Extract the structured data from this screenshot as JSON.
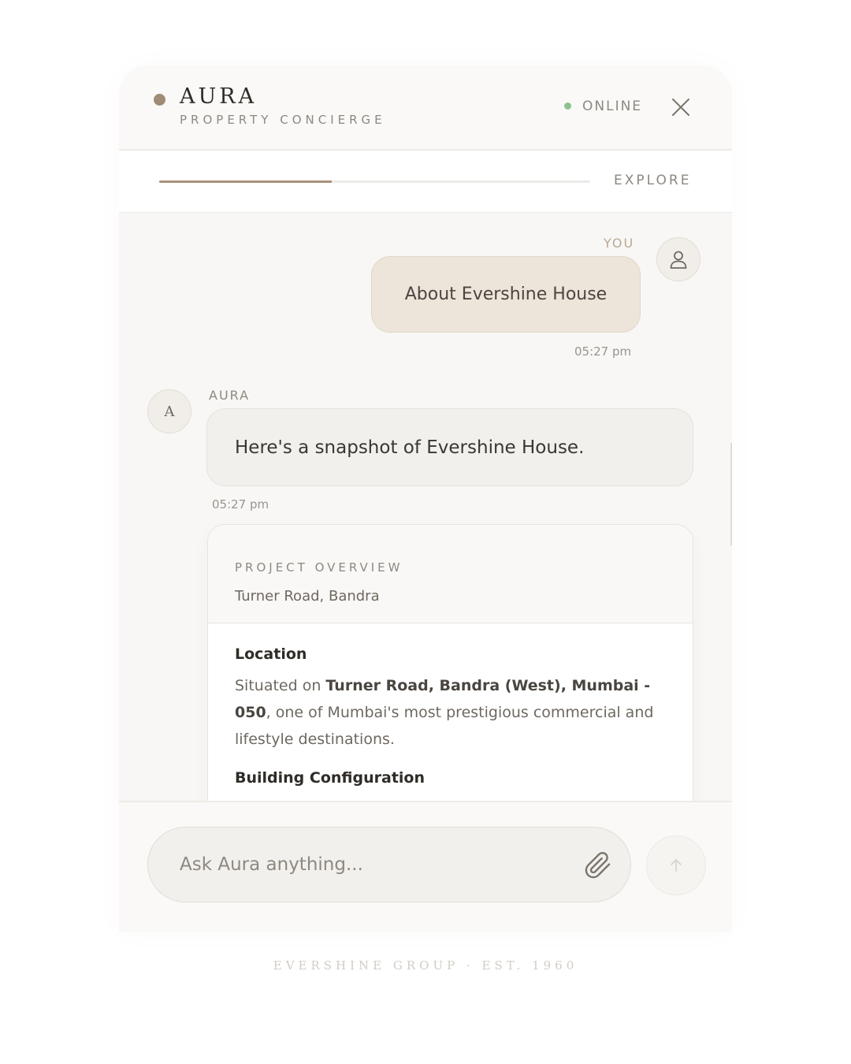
{
  "header": {
    "brand_name": "AURA",
    "brand_subtitle": "PROPERTY CONCIERGE",
    "status": "ONLINE",
    "status_color": "#8cc190",
    "accent_color": "#a08c76",
    "close_icon": "close-icon"
  },
  "progress": {
    "label": "EXPLORE",
    "value_fraction": 0.4
  },
  "chat": {
    "user_message": {
      "sender": "YOU",
      "text": "About Evershine House",
      "time": "05:27 pm",
      "avatar_icon": "user-icon"
    },
    "bot_message": {
      "sender": "AURA",
      "avatar_letter": "A",
      "text": "Here's a snapshot of Evershine House.",
      "time": "05:27 pm"
    },
    "card": {
      "kicker": "PROJECT OVERVIEW",
      "subtitle": "Turner Road, Bandra",
      "location_title": "Location",
      "location_prefix": "Situated on ",
      "location_bold": "Turner Road, Bandra (West), Mumbai - 050",
      "location_suffix": ", one of Mumbai's most prestigious commercial and lifestyle destinations.",
      "config_title": "Building Configuration"
    }
  },
  "composer": {
    "placeholder": "Ask Aura anything...",
    "attach_icon": "paperclip-icon",
    "send_icon": "arrow-up-icon"
  },
  "footer": {
    "text": "EVERSHINE GROUP · EST. 1960"
  }
}
